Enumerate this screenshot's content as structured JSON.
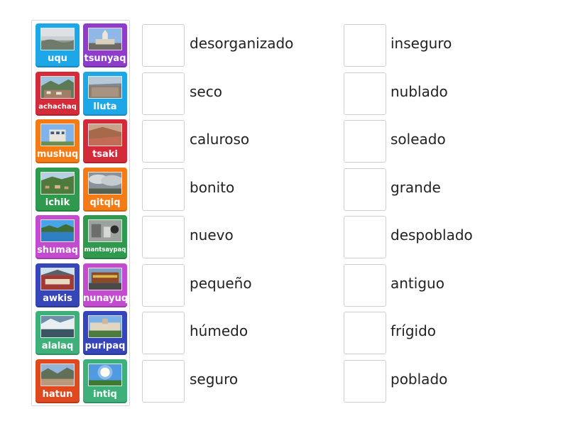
{
  "tiles": [
    {
      "label": "uqu",
      "color": "#1ea7e6",
      "scene": "fog"
    },
    {
      "label": "tsunyaq",
      "color": "#8e3cc9",
      "scene": "church"
    },
    {
      "label": "achachaq",
      "color": "#d42b3b",
      "scene": "town"
    },
    {
      "label": "lluta",
      "color": "#1ea7e6",
      "scene": "city"
    },
    {
      "label": "mushuq",
      "color": "#f47b16",
      "scene": "newbuilding"
    },
    {
      "label": "tsaki",
      "color": "#d42b3b",
      "scene": "dryhill"
    },
    {
      "label": "ichik",
      "color": "#2f9a4e",
      "scene": "village"
    },
    {
      "label": "qitqiq",
      "color": "#f47b16",
      "scene": "clouds"
    },
    {
      "label": "shumaq",
      "color": "#c24bd0",
      "scene": "lake"
    },
    {
      "label": "mantsaypaq",
      "color": "#2f9a4e",
      "scene": "ruins"
    },
    {
      "label": "awkis",
      "color": "#3645b8",
      "scene": "market"
    },
    {
      "label": "nunayuq",
      "color": "#c24bd0",
      "scene": "street"
    },
    {
      "label": "alalaq",
      "color": "#3fb07a",
      "scene": "snow"
    },
    {
      "label": "puripaq",
      "color": "#3645b8",
      "scene": "plaza"
    },
    {
      "label": "hatun",
      "color": "#e0491f",
      "scene": "valley"
    },
    {
      "label": "intiq",
      "color": "#3fb07a",
      "scene": "sun"
    }
  ],
  "left_words": [
    "desorganizado",
    "seco",
    "caluroso",
    "bonito",
    "nuevo",
    "pequeño",
    "húmedo",
    "seguro"
  ],
  "right_words": [
    "inseguro",
    "nublado",
    "soleado",
    "grande",
    "despoblado",
    "antiguo",
    "frígido",
    "poblado"
  ]
}
